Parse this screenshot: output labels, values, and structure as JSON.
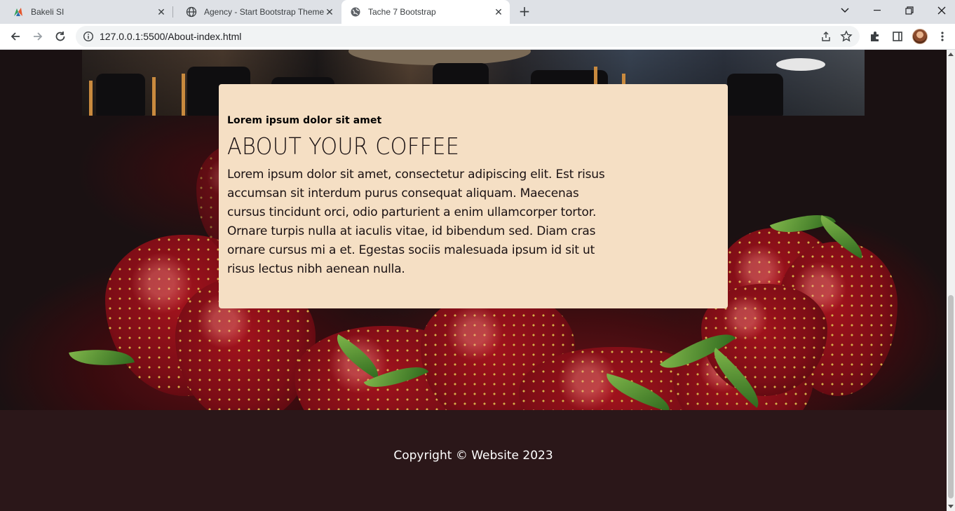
{
  "browser": {
    "tabs": [
      {
        "title": "Bakeli SI",
        "icon": "bakeli-favicon",
        "active": false
      },
      {
        "title": "Agency - Start Bootstrap Theme",
        "icon": "globe-icon",
        "active": false
      },
      {
        "title": "Tache 7 Bootstrap",
        "icon": "globe-icon",
        "active": true
      }
    ],
    "url": "127.0.0.1:5500/About-index.html",
    "new_tab_symbol": "+",
    "close_symbol": "✕"
  },
  "page": {
    "card": {
      "subtitle": "Lorem ipsum dolor sit amet",
      "heading": "ABOUT YOUR COFFEE",
      "paragraph": "Lorem ipsum dolor sit amet, consectetur adipiscing elit. Est risus accumsan sit interdum purus consequat aliquam. Maecenas cursus tincidunt orci, odio parturient a enim ullamcorper tortor. Ornare turpis nulla at iaculis vitae, id bibendum sed. Diam cras ornare cursus mi a et. Egestas sociis malesuada ipsum id sit ut risus lectus nibh aenean nulla."
    },
    "footer": {
      "copyright": "Copyright © Website 2023"
    }
  },
  "colors": {
    "card_bg": "#f5dfc4",
    "footer_bg": "#2b1719",
    "page_bg": "#1a1112"
  }
}
